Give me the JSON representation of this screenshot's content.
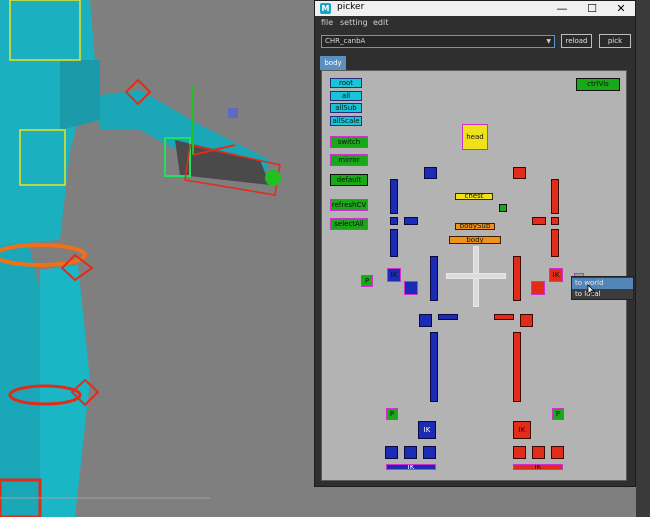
{
  "window": {
    "title": "picker",
    "app_icon": "maya-icon",
    "minimize": "—",
    "maximize": "☐",
    "close": "✕"
  },
  "menu": {
    "file": "file",
    "setting": "setting",
    "edit": "edit"
  },
  "toolbar": {
    "character": "CHR_canbA",
    "reload": "reload",
    "pick": "pick"
  },
  "tabs": {
    "body": "body"
  },
  "buttons": {
    "root": "root",
    "all": "all",
    "allsub": "allSub",
    "allscale": "allScale",
    "switch": "switch",
    "mirror": "mirror",
    "default": "default",
    "refreshcv": "refreshCV",
    "selectall": "selectAll",
    "ctrlvis": "ctrlVis"
  },
  "controls": {
    "head": "head",
    "chest": "chest",
    "bodysub": "bodySub",
    "body": "body",
    "p_label": "P",
    "ik_label": "IK"
  },
  "context_menu": {
    "to_world": "to world",
    "to_local": "to local"
  },
  "colors": {
    "cyan": "#16c5d8",
    "green": "#18a818",
    "blue": "#1c2bb5",
    "red": "#e22c1a",
    "yellow": "#f0e21a",
    "orange": "#f0921a",
    "magenta": "#d030d0"
  }
}
